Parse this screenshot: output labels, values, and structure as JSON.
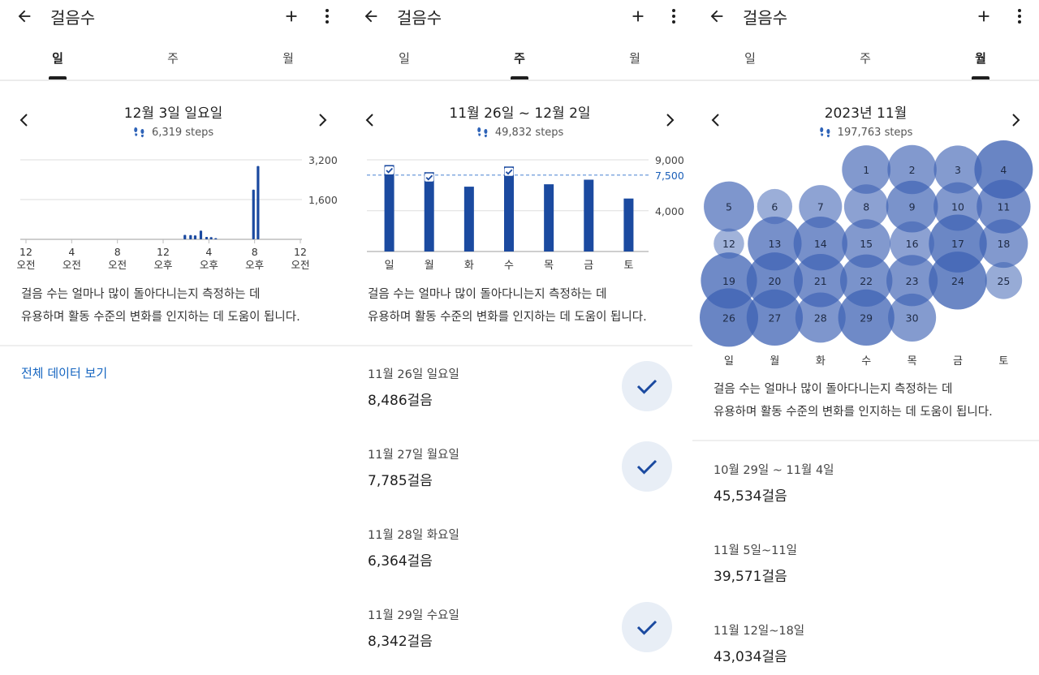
{
  "colors": {
    "bar": "#1b4aa0",
    "bubble": "#3f63b4",
    "goal_line": "#5b8fd6",
    "link": "#1565c0",
    "check_bg": "#e8eef6",
    "check": "#1b4aa0"
  },
  "icons": {
    "back": "arrow-left-icon",
    "add": "plus-icon",
    "more": "more-vert-icon",
    "prev": "chevron-left-icon",
    "next": "chevron-right-icon",
    "steps": "footsteps-icon",
    "check": "check-icon"
  },
  "panels": {
    "day": {
      "app_title": "걸음수",
      "tabs": [
        {
          "label": "일",
          "active": true
        },
        {
          "label": "주",
          "active": false
        },
        {
          "label": "월",
          "active": false
        }
      ],
      "period_title": "12월 3일 일요일",
      "steps_text": "6,319 steps",
      "description": [
        "걸음 수는 얼마나 많이 돌아다니는지 측정하는 데",
        "유용하며 활동 수준의 변화를 인지하는 데 도움이 됩니다."
      ],
      "link": "전체 데이터 보기"
    },
    "week": {
      "app_title": "걸음수",
      "tabs": [
        {
          "label": "일",
          "active": false
        },
        {
          "label": "주",
          "active": true
        },
        {
          "label": "월",
          "active": false
        }
      ],
      "period_title": "11월 26일 ~ 12월 2일",
      "steps_text": "49,832 steps",
      "description": [
        "걸음 수는 얼마나 많이 돌아다니는지 측정하는 데",
        "유용하며 활동 수준의 변화를 인지하는 데 도움이 됩니다."
      ],
      "list": [
        {
          "label": "11월 26일 일요일",
          "value": "8,486걸음",
          "checked": true
        },
        {
          "label": "11월 27일 월요일",
          "value": "7,785걸음",
          "checked": true
        },
        {
          "label": "11월 28일 화요일",
          "value": "6,364걸음",
          "checked": false
        },
        {
          "label": "11월 29일 수요일",
          "value": "8,342걸음",
          "checked": true
        }
      ]
    },
    "month": {
      "app_title": "걸음수",
      "tabs": [
        {
          "label": "일",
          "active": false
        },
        {
          "label": "주",
          "active": false
        },
        {
          "label": "월",
          "active": true
        }
      ],
      "period_title": "2023년 11월",
      "steps_text": "197,763 steps",
      "description": [
        "걸음 수는 얼마나 많이 돌아다니는지 측정하는 데",
        "유용하며 활동 수준의 변화를 인지하는 데 도움이 됩니다."
      ],
      "list": [
        {
          "label": "10월 29일 ~ 11월 4일",
          "value": "45,534걸음"
        },
        {
          "label": "11월 5일~11일",
          "value": "39,571걸음"
        },
        {
          "label": "11월 12일~18일",
          "value": "43,034걸음"
        }
      ]
    }
  },
  "chart_data": [
    {
      "type": "bar",
      "ylim": [
        0,
        3200
      ],
      "yticks": [
        1600,
        3200
      ],
      "yticklabels": [
        "1,600",
        "3,200"
      ],
      "xticks": [
        0,
        4,
        8,
        12,
        16,
        20,
        24
      ],
      "xticklabels": [
        [
          "12",
          "오전"
        ],
        [
          "4",
          "오전"
        ],
        [
          "8",
          "오전"
        ],
        [
          "12",
          "오후"
        ],
        [
          "4",
          "오후"
        ],
        [
          "8",
          "오후"
        ],
        [
          "12",
          "오전"
        ]
      ],
      "points": [
        {
          "x": 13.9,
          "y": 180
        },
        {
          "x": 14.4,
          "y": 170
        },
        {
          "x": 14.8,
          "y": 160
        },
        {
          "x": 15.3,
          "y": 350
        },
        {
          "x": 15.8,
          "y": 100
        },
        {
          "x": 16.2,
          "y": 90
        },
        {
          "x": 16.6,
          "y": 50
        },
        {
          "x": 19.9,
          "y": 2000
        },
        {
          "x": 20.3,
          "y": 2950
        }
      ]
    },
    {
      "type": "bar",
      "ylim": [
        0,
        9000
      ],
      "yticks": [
        4000,
        9000
      ],
      "yticklabels": [
        "4,000",
        "9,000"
      ],
      "goal": 7500,
      "goal_label": "7,500",
      "categories": [
        "일",
        "월",
        "화",
        "수",
        "목",
        "금",
        "토"
      ],
      "values": [
        8486,
        7785,
        6364,
        8342,
        6600,
        7050,
        5200
      ],
      "checked": [
        true,
        true,
        false,
        true,
        false,
        false,
        false
      ]
    },
    {
      "type": "bubble",
      "columns": [
        "일",
        "월",
        "화",
        "수",
        "목",
        "금",
        "토"
      ],
      "days": [
        {
          "day": 1,
          "col": 3,
          "row": 0,
          "value": 6000
        },
        {
          "day": 2,
          "col": 4,
          "row": 0,
          "value": 6200
        },
        {
          "day": 3,
          "col": 5,
          "row": 0,
          "value": 5800
        },
        {
          "day": 4,
          "col": 6,
          "row": 0,
          "value": 10000
        },
        {
          "day": 5,
          "col": 0,
          "row": 1,
          "value": 6600
        },
        {
          "day": 6,
          "col": 1,
          "row": 1,
          "value": 2200
        },
        {
          "day": 7,
          "col": 2,
          "row": 1,
          "value": 4200
        },
        {
          "day": 8,
          "col": 3,
          "row": 1,
          "value": 4600
        },
        {
          "day": 9,
          "col": 4,
          "row": 1,
          "value": 7200
        },
        {
          "day": 10,
          "col": 5,
          "row": 1,
          "value": 6000
        },
        {
          "day": 11,
          "col": 6,
          "row": 1,
          "value": 8000
        },
        {
          "day": 12,
          "col": 0,
          "row": 2,
          "value": 1300
        },
        {
          "day": 13,
          "col": 1,
          "row": 2,
          "value": 8000
        },
        {
          "day": 14,
          "col": 2,
          "row": 2,
          "value": 8000
        },
        {
          "day": 15,
          "col": 3,
          "row": 2,
          "value": 6000
        },
        {
          "day": 16,
          "col": 4,
          "row": 2,
          "value": 4600
        },
        {
          "day": 17,
          "col": 5,
          "row": 2,
          "value": 9800
        },
        {
          "day": 18,
          "col": 6,
          "row": 2,
          "value": 6000
        },
        {
          "day": 19,
          "col": 0,
          "row": 3,
          "value": 9000
        },
        {
          "day": 20,
          "col": 1,
          "row": 3,
          "value": 9000
        },
        {
          "day": 21,
          "col": 2,
          "row": 3,
          "value": 7800
        },
        {
          "day": 22,
          "col": 3,
          "row": 3,
          "value": 7400
        },
        {
          "day": 23,
          "col": 4,
          "row": 3,
          "value": 7000
        },
        {
          "day": 24,
          "col": 5,
          "row": 3,
          "value": 9800
        },
        {
          "day": 25,
          "col": 6,
          "row": 3,
          "value": 2600
        },
        {
          "day": 26,
          "col": 0,
          "row": 4,
          "value": 10000
        },
        {
          "day": 27,
          "col": 1,
          "row": 4,
          "value": 9000
        },
        {
          "day": 28,
          "col": 2,
          "row": 4,
          "value": 6600
        },
        {
          "day": 29,
          "col": 3,
          "row": 4,
          "value": 9000
        },
        {
          "day": 30,
          "col": 4,
          "row": 4,
          "value": 5800
        }
      ]
    }
  ]
}
